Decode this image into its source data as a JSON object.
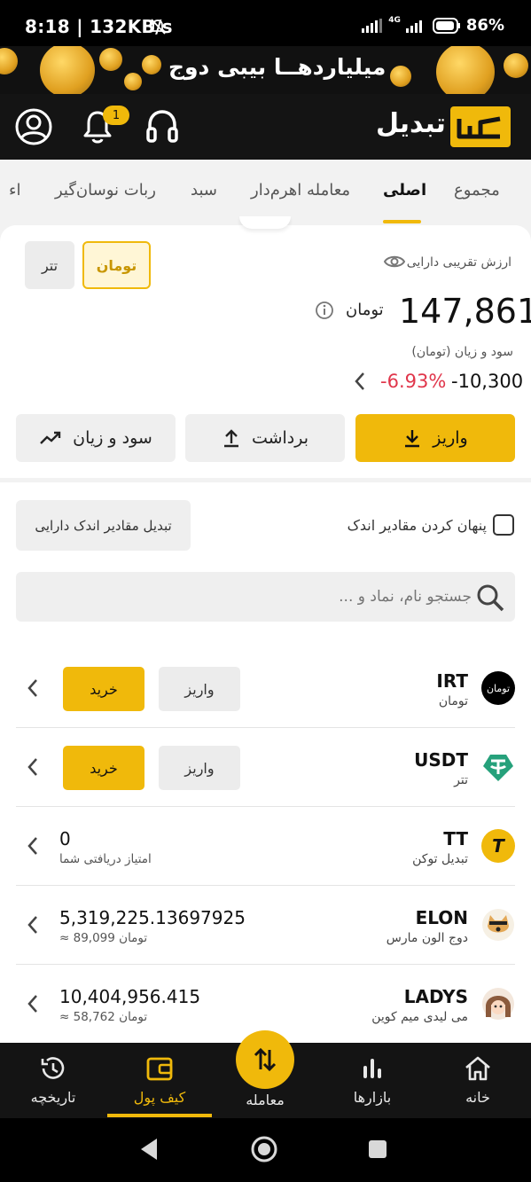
{
  "status_bar": {
    "time": "8:18 | 132KB/s",
    "network": "4G",
    "battery": "86%"
  },
  "banner": {
    "text": "میلیاردهــا بیبی دوج"
  },
  "header": {
    "logo_text": "تبدیل",
    "notification_count": "1"
  },
  "tabs": [
    "مجموع",
    "اصلی",
    "معامله اهرم‌دار",
    "سبد",
    "ربات نوسان‌گیر",
    "اء"
  ],
  "active_tab": "اصلی",
  "summary": {
    "asset_label": "ارزش تقریبی دارایی",
    "currency_toman": "تومان",
    "currency_tether": "تتر",
    "total_value": "147,861",
    "total_unit": "تومان",
    "pnl_label": "سود و زیان (تومان)",
    "pnl_value": "-10,300",
    "pnl_percent": "-6.93%",
    "deposit_label": "واریز",
    "withdraw_label": "برداشت",
    "pnl_button_label": "سود و زیان"
  },
  "tools": {
    "hide_small_label": "پنهان کردن مقادیر اندک",
    "convert_small_label": "تبدیل مقادیر اندک دارایی",
    "search_placeholder": "جستجو نام، نماد و ..."
  },
  "assets": [
    {
      "symbol": "IRT",
      "name": "تومان",
      "icon_text": "تومان",
      "deposit": "واریز",
      "buy": "خرید"
    },
    {
      "symbol": "USDT",
      "name": "تتر",
      "deposit": "واریز",
      "buy": "خرید"
    },
    {
      "symbol": "TT",
      "name": "تبدیل توکن",
      "amount": "0",
      "note": "امتیاز دریافتی شما"
    },
    {
      "symbol": "ELON",
      "name": "دوج الون مارس",
      "amount": "5,319,225.13697925",
      "note": "تومان 89,099 ≈"
    },
    {
      "symbol": "LADYS",
      "name": "می لیدی میم کوین",
      "amount": "10,404,956.415",
      "note": "تومان 58,762 ≈"
    }
  ],
  "bottom_nav": {
    "home": "خانه",
    "markets": "بازارها",
    "trade": "معامله",
    "wallet": "کیف پول",
    "history": "تاریخچه"
  },
  "colors": {
    "accent": "#f0b90b",
    "negative": "#e0364b",
    "dark": "#141414"
  }
}
